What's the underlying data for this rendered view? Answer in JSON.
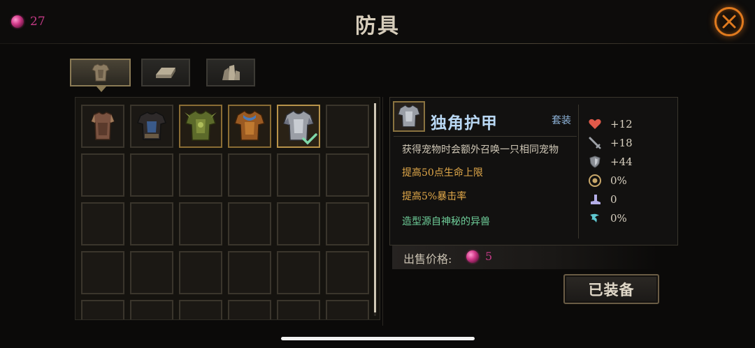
{
  "header": {
    "currency_icon": "gem-icon",
    "currency_value": "27",
    "title": "防具",
    "close_icon": "close-icon",
    "accent_color": "#e07a1e"
  },
  "tabs": [
    {
      "icon": "armor-icon",
      "active": true
    },
    {
      "icon": "ingot-icon",
      "active": false
    },
    {
      "icon": "crystal-icon",
      "active": false
    }
  ],
  "inventory": {
    "slots_visible": 30,
    "items": [
      {
        "icon": "leather-armor-icon",
        "rarity": "common",
        "equipped": false
      },
      {
        "icon": "dark-armor-icon",
        "rarity": "common",
        "equipped": false
      },
      {
        "icon": "green-beast-armor-icon",
        "rarity": "gold",
        "equipped": false
      },
      {
        "icon": "bronze-armor-icon",
        "rarity": "gold",
        "equipped": false
      },
      {
        "icon": "unicorn-plate-armor-icon",
        "rarity": "gold",
        "equipped": true
      }
    ]
  },
  "detail": {
    "name": "独角护甲",
    "set_label": "套装",
    "name_color": "#b9d8f4",
    "descriptions": [
      {
        "text": "获得宠物时会额外召唤一只相同宠物",
        "color": "#cfc7b6"
      },
      {
        "text": "提高50点生命上限",
        "color": "#e2a94a"
      },
      {
        "text": "提高5%暴击率",
        "color": "#e2a94a"
      },
      {
        "text": "造型源自神秘的异兽",
        "color": "#6fcf9a"
      }
    ],
    "stats": [
      {
        "icon": "heart-icon",
        "value": "+12"
      },
      {
        "icon": "sword-icon",
        "value": "+18"
      },
      {
        "icon": "shield-icon",
        "value": "+44"
      },
      {
        "icon": "target-icon",
        "value": "0%"
      },
      {
        "icon": "boot-icon",
        "value": "0"
      },
      {
        "icon": "wind-icon",
        "value": "0%"
      }
    ]
  },
  "sell": {
    "label": "出售价格:",
    "gem_icon": "gem-icon",
    "value": "5"
  },
  "equip_button": {
    "label": "已装备"
  }
}
